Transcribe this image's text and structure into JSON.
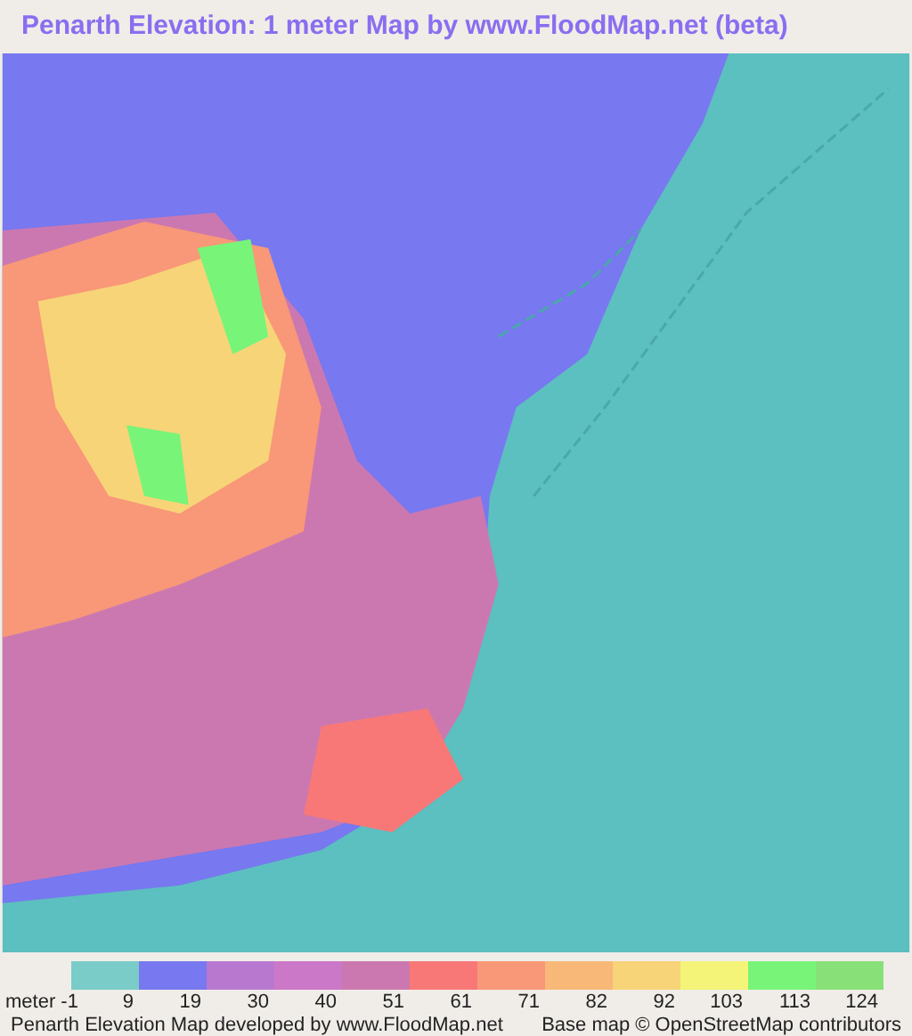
{
  "title": "Penarth Elevation: 1 meter Map by www.FloodMap.net (beta)",
  "legend": {
    "unit_label": "meter -1",
    "swatches": [
      {
        "color": "#7accc8",
        "label": "9"
      },
      {
        "color": "#7878f0",
        "label": "19"
      },
      {
        "color": "#b878d0",
        "label": "30"
      },
      {
        "color": "#cc78c8",
        "label": "40"
      },
      {
        "color": "#cc78b0",
        "label": "51"
      },
      {
        "color": "#f87878",
        "label": "61"
      },
      {
        "color": "#f89878",
        "label": "71"
      },
      {
        "color": "#f8b878",
        "label": "82"
      },
      {
        "color": "#f8d478",
        "label": "92"
      },
      {
        "color": "#f4f478",
        "label": "103"
      },
      {
        "color": "#78f478",
        "label": "113"
      },
      {
        "color": "#88e078",
        "label": "124"
      }
    ]
  },
  "footer": {
    "left": "Penarth Elevation Map developed by www.FloodMap.net",
    "right": "Base map © OpenStreetMap contributors"
  }
}
